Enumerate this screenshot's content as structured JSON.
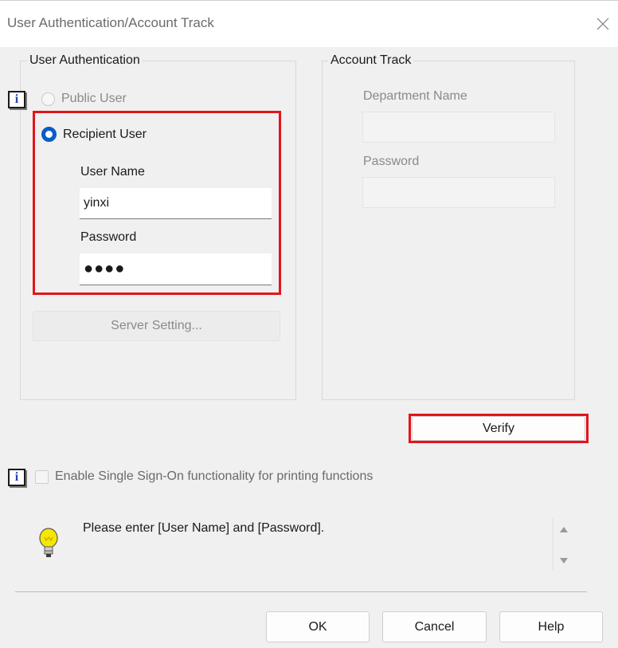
{
  "window": {
    "title": "User Authentication/Account Track"
  },
  "user_auth": {
    "legend": "User Authentication",
    "public_user": {
      "label": "Public User",
      "selected": false,
      "enabled": false
    },
    "recipient_user": {
      "label": "Recipient User",
      "selected": true
    },
    "user_name_label": "User Name",
    "user_name_value": "yinxi",
    "password_label": "Password",
    "password_value": "●●●●",
    "server_setting_label": "Server Setting..."
  },
  "account_track": {
    "legend": "Account Track",
    "department_name_label": "Department Name",
    "department_name_value": "",
    "password_label": "Password",
    "password_value": ""
  },
  "verify_label": "Verify",
  "sso": {
    "label": "Enable Single Sign-On functionality for printing functions",
    "checked": false
  },
  "message": "Please enter [User Name] and [Password].",
  "icons": {
    "info": "info-icon",
    "tip": "lightbulb-icon",
    "close": "close-icon"
  },
  "colors": {
    "highlight": "#e3141b",
    "accent": "#0a5cc6",
    "info_letter": "#2346b3"
  },
  "info_letter": "i",
  "footer": {
    "ok_label": "OK",
    "cancel_label": "Cancel",
    "help_label": "Help"
  }
}
